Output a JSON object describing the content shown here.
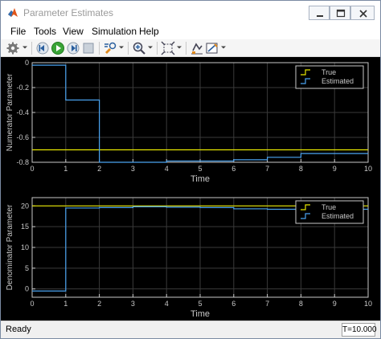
{
  "window": {
    "title": "Parameter Estimates",
    "controls": {
      "minimize": "minimize",
      "maximize": "maximize",
      "close": "close"
    }
  },
  "menu": [
    "File",
    "Tools",
    "View",
    "Simulation",
    "Help"
  ],
  "toolbar": {
    "icons": [
      "gear-icon",
      "step-back-icon",
      "run-icon",
      "step-forward-icon",
      "stop-icon",
      "highlight-icon",
      "zoom-icon",
      "fit-to-view-icon",
      "signal-icon",
      "style-icon"
    ]
  },
  "status": {
    "left": "Ready",
    "right": "T=10.000"
  },
  "colors": {
    "true_series": "#e6e600",
    "estimated_series": "#4aa3f0",
    "plot_bg": "#000000",
    "grid": "#3a3a3a",
    "axis": "#c8c8c8"
  },
  "chart_data": [
    {
      "type": "line",
      "ylabel": "Numerator Parameter",
      "xlabel": "Time",
      "xlim": [
        0,
        10
      ],
      "ylim": [
        -0.8,
        0
      ],
      "xticks": [
        "0",
        "1",
        "2",
        "3",
        "4",
        "5",
        "6",
        "7",
        "8",
        "9",
        "10"
      ],
      "yticks": [
        "0",
        "-0.2",
        "-0.4",
        "-0.6",
        "-0.8"
      ],
      "ytick_values": [
        0,
        -0.2,
        -0.4,
        -0.6,
        -0.8
      ],
      "grid": true,
      "legend": {
        "position": "top-right",
        "entries": [
          "True",
          "Estimated"
        ]
      },
      "series": [
        {
          "name": "True",
          "x": [
            0,
            10
          ],
          "y": [
            -0.7,
            -0.7
          ],
          "step": false
        },
        {
          "name": "Estimated",
          "x": [
            0,
            1,
            2,
            3,
            4,
            5,
            6,
            7,
            8,
            9,
            10
          ],
          "y": [
            -0.02,
            -0.3,
            -0.8,
            -0.8,
            -0.79,
            -0.79,
            -0.78,
            -0.76,
            -0.73,
            -0.73,
            -0.73
          ],
          "step": true
        }
      ]
    },
    {
      "type": "line",
      "ylabel": "Denominator Parameter",
      "xlabel": "Time",
      "xlim": [
        0,
        10
      ],
      "ylim": [
        -2,
        22
      ],
      "xticks": [
        "0",
        "1",
        "2",
        "3",
        "4",
        "5",
        "6",
        "7",
        "8",
        "9",
        "10"
      ],
      "yticks": [
        "20",
        "15",
        "10",
        "5",
        "0"
      ],
      "ytick_values": [
        20,
        15,
        10,
        5,
        0
      ],
      "grid": true,
      "legend": {
        "position": "top-right",
        "entries": [
          "True",
          "Estimated"
        ]
      },
      "series": [
        {
          "name": "True",
          "x": [
            0,
            10
          ],
          "y": [
            20,
            20
          ],
          "step": false
        },
        {
          "name": "Estimated",
          "x": [
            0,
            1,
            2,
            3,
            4,
            5,
            6,
            7,
            8,
            9,
            10
          ],
          "y": [
            -0.5,
            19.5,
            19.6,
            19.8,
            19.7,
            19.6,
            19.3,
            19.2,
            19.2,
            19.2,
            19.2
          ],
          "step": true
        }
      ]
    }
  ]
}
